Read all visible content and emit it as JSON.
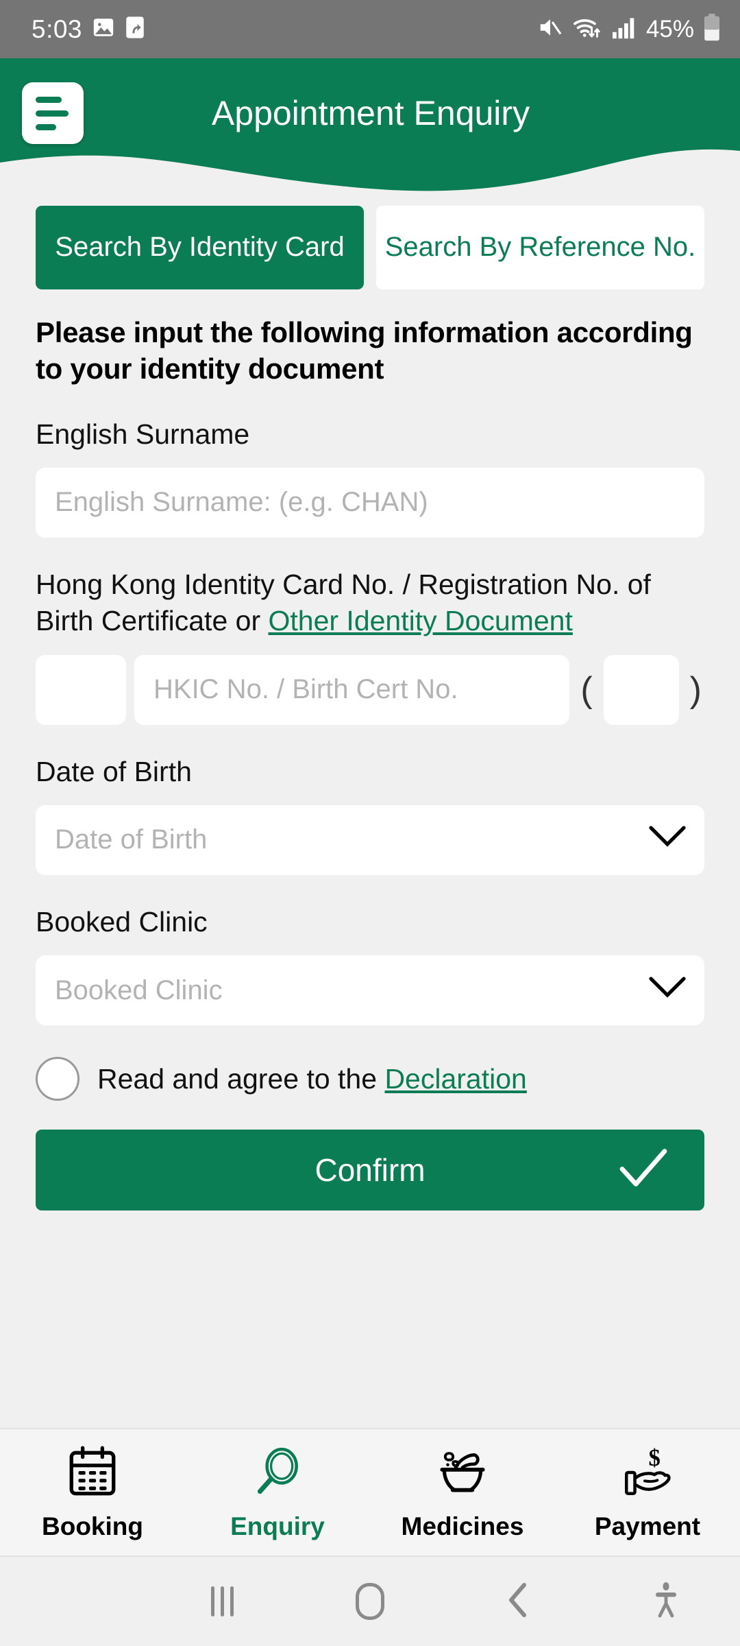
{
  "statusbar": {
    "time": "5:03",
    "battery_percent": "45%",
    "icons": [
      "image-icon",
      "share-icon",
      "mute-icon",
      "wifi-icon",
      "signal-icon",
      "battery-icon"
    ]
  },
  "header": {
    "title": "Appointment Enquiry",
    "menu_icon": "hamburger-menu-icon",
    "background_color": "#0B7D54"
  },
  "tabs": [
    {
      "label": "Search By Identity Card",
      "active": true
    },
    {
      "label": "Search By Reference No.",
      "active": false
    }
  ],
  "form": {
    "lead_text": "Please input the following information according to your identity document",
    "surname": {
      "label": "English Surname",
      "placeholder": "English Surname: (e.g. CHAN)",
      "value": ""
    },
    "hkic": {
      "label_part1": "Hong Kong Identity Card No. / Registration No. of Birth Certificate or ",
      "label_link": "Other Identity Document",
      "prefix_value": "",
      "placeholder": "HKIC No. / Birth Cert No.",
      "value": "",
      "paren_open": "(",
      "check_digit_value": "",
      "paren_close": ")"
    },
    "dob": {
      "label": "Date of Birth",
      "placeholder": "Date of Birth",
      "value": "",
      "icon": "chevron-down-icon"
    },
    "clinic": {
      "label": "Booked Clinic",
      "placeholder": "Booked Clinic",
      "value": "",
      "icon": "chevron-down-icon"
    },
    "declaration": {
      "checked": false,
      "text": "Read and agree to the ",
      "link": "Declaration"
    },
    "confirm": {
      "label": "Confirm",
      "icon": "check-icon"
    }
  },
  "bottom_nav": [
    {
      "label": "Booking",
      "icon": "calendar-icon",
      "active": false
    },
    {
      "label": "Enquiry",
      "icon": "magnifier-icon",
      "active": true
    },
    {
      "label": "Medicines",
      "icon": "mortar-pestle-icon",
      "active": false
    },
    {
      "label": "Payment",
      "icon": "hand-dollar-icon",
      "active": false
    }
  ],
  "android_nav": {
    "recents": "recents-icon",
    "home": "home-icon",
    "back": "back-icon",
    "accessibility": "accessibility-icon"
  },
  "colors": {
    "brand_green": "#0B7D54",
    "page_bg": "#F0F0F0",
    "status_bar": "#757575"
  }
}
